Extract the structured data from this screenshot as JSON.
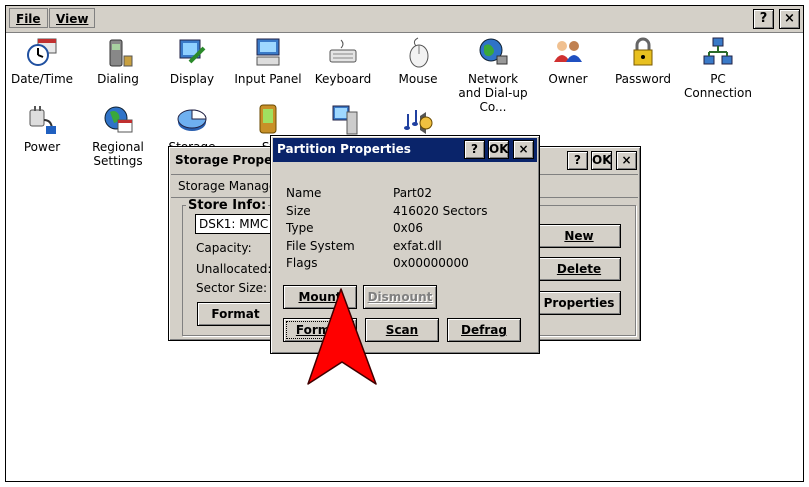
{
  "menu": {
    "file": "File",
    "view": "View"
  },
  "window_buttons": {
    "help": "?",
    "close": "×"
  },
  "control_panel": {
    "items": [
      {
        "label": "Date/Time",
        "icon": "clock-icon"
      },
      {
        "label": "Dialing",
        "icon": "phone-icon"
      },
      {
        "label": "Display",
        "icon": "display-icon"
      },
      {
        "label": "Input Panel",
        "icon": "input-panel-icon"
      },
      {
        "label": "Keyboard",
        "icon": "keyboard-icon"
      },
      {
        "label": "Mouse",
        "icon": "mouse-icon"
      },
      {
        "label": "Network and Dial-up Co...",
        "icon": "network-globe-icon"
      },
      {
        "label": "Owner",
        "icon": "owner-icon"
      },
      {
        "label": "Password",
        "icon": "padlock-icon"
      },
      {
        "label": "PC Connection",
        "icon": "pc-connection-icon"
      },
      {
        "label": "Power",
        "icon": "power-plug-icon"
      },
      {
        "label": "Regional Settings",
        "icon": "regional-settings-icon"
      },
      {
        "label": "Storage",
        "icon": "storage-pie-icon"
      },
      {
        "label": "St",
        "icon": "stylus-icon"
      },
      {
        "label": "",
        "icon": "system-icon"
      },
      {
        "label": "",
        "icon": "volume-icon"
      }
    ]
  },
  "storage_properties": {
    "title": "Storage Propert",
    "tab": "Storage Manager",
    "store_info_label": "Store Info:",
    "store_select": "DSK1: MMC C",
    "capacity_label": "Capacity:",
    "unallocated_label": "Unallocated:",
    "sector_size_label": "Sector Size:",
    "format_button": "Format",
    "new_button": "New",
    "delete_button": "Delete",
    "properties_button": "Properties",
    "help": "?",
    "ok": "OK",
    "close": "×"
  },
  "partition_properties": {
    "title": "Partition Properties",
    "help": "?",
    "ok": "OK",
    "close": "×",
    "fields": [
      {
        "label": "Name",
        "value": "Part02"
      },
      {
        "label": "Size",
        "value": "416020 Sectors"
      },
      {
        "label": "Type",
        "value": "0x06"
      },
      {
        "label": "File System",
        "value": "exfat.dll"
      },
      {
        "label": "Flags",
        "value": "0x00000000"
      }
    ],
    "mount_button": "Mount",
    "dismount_button": "Dismount",
    "format_button": "Format",
    "scan_button": "Scan",
    "defrag_button": "Defrag"
  },
  "colors": {
    "title_active": "#0a246a",
    "title_inactive": "#808080",
    "pointer_arrow": "#ff0000"
  }
}
